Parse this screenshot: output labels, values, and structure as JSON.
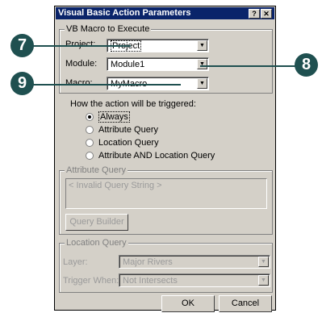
{
  "dialog": {
    "title": "Visual Basic Action Parameters",
    "help_label": "?",
    "close_label": "✕"
  },
  "vb_group": {
    "label": "VB Macro to Execute",
    "project_label": "Project:",
    "project_value": "Project",
    "module_label": "Module:",
    "module_value": "Module1",
    "macro_label": "Macro:",
    "macro_value": "MyMacro"
  },
  "trigger": {
    "heading": "How the action will be triggered:",
    "options": [
      "Always",
      "Attribute Query",
      "Location Query",
      "Attribute AND Location Query"
    ],
    "selected": "Always"
  },
  "attribute_query": {
    "label": "Attribute Query",
    "text": "< Invalid Query String >",
    "builder_label": "Query Builder"
  },
  "location_query": {
    "label": "Location Query",
    "layer_label": "Layer:",
    "layer_value": "Major Rivers",
    "trigger_label": "Trigger When:",
    "trigger_value": "Not Intersects"
  },
  "footer": {
    "ok_label": "OK",
    "cancel_label": "Cancel"
  },
  "callouts": [
    "7",
    "8",
    "9"
  ],
  "colors": {
    "callout": "#1f5050",
    "titlebar": "#0a246a",
    "dialog_face": "#d4d0c8"
  }
}
